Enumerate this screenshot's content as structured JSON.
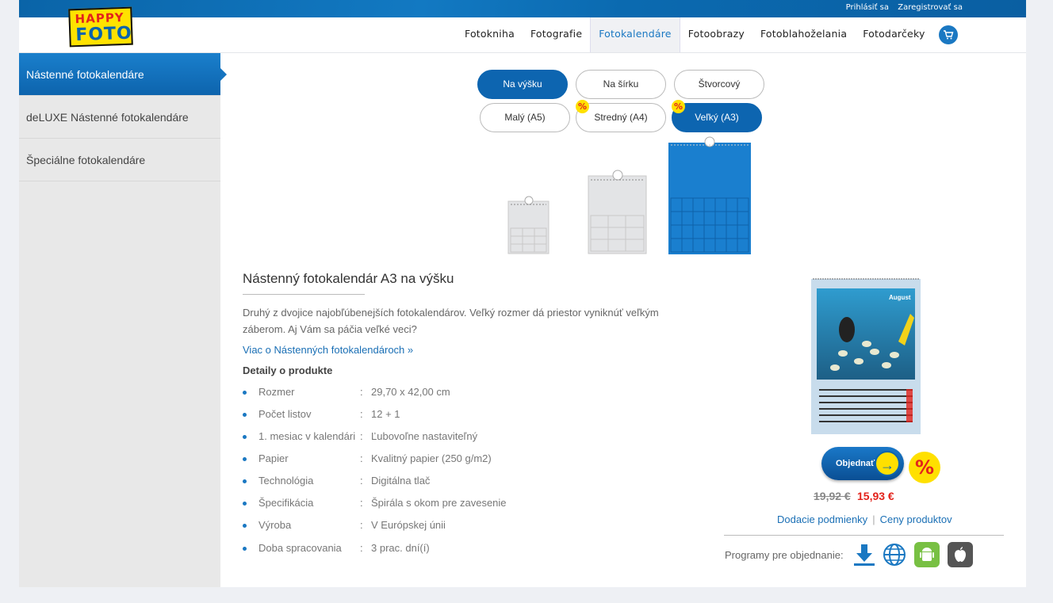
{
  "header": {
    "login": "Prihlásiť sa",
    "register": "Zaregistrovať sa",
    "logo_line1": "HAPPY",
    "logo_line2": "FOTO"
  },
  "nav": [
    {
      "label": "Fotokniha"
    },
    {
      "label": "Fotografie"
    },
    {
      "label": "Fotokalendáre",
      "active": true
    },
    {
      "label": "Fotoobrazy"
    },
    {
      "label": "Fotoblahoželania"
    },
    {
      "label": "Fotodarčeky"
    }
  ],
  "sidebar": [
    {
      "label": "Nástenné fotokalendáre",
      "active": true
    },
    {
      "label": "deLUXE Nástenné fotokalendáre"
    },
    {
      "label": "Špeciálne fotokalendáre"
    }
  ],
  "orientation": [
    "Na výšku",
    "Na šírku",
    "Štvorcový"
  ],
  "sizes": [
    "Malý (A5)",
    "Stredný (A4)",
    "Veľký (A3)"
  ],
  "pct_symbol": "%",
  "product": {
    "title": "Nástenný fotokalendár A3 na výšku",
    "description": "Druhý z dvojice najobľúbenejších fotokalendárov. Veľký rozmer dá priestor vyniknúť veľkým záberom. Aj Vám sa páčia veľké veci?",
    "more_link": "Viac o Nástenných fotokalendároch »",
    "details_heading": "Detaily o produkte",
    "specs": [
      {
        "key": "Rozmer",
        "value": "29,70 x 42,00 cm"
      },
      {
        "key": "Počet listov",
        "value": "12 + 1"
      },
      {
        "key": "1. mesiac v kalendári",
        "value": "Ľubovoľne nastaviteľný"
      },
      {
        "key": "Papier",
        "value": "Kvalitný papier (250 g/m2)"
      },
      {
        "key": "Technológia",
        "value": "Digitálna tlač"
      },
      {
        "key": "Špecifikácia",
        "value": "Špirála s okom pre zavesenie"
      },
      {
        "key": "Výroba",
        "value": "V Európskej únii"
      },
      {
        "key": "Doba spracovania",
        "value": "3 prac. dní(í)"
      }
    ],
    "spec_colon": ":",
    "calendar_month": "August",
    "order_button": "Objednať",
    "old_price": "19,92 €",
    "new_price": "15,93 €",
    "delivery_link": "Dodacie podmienky",
    "link_sep": "|",
    "prices_link": "Ceny produktov",
    "programs_label": "Programy pre objednanie:"
  },
  "colors": {
    "brand_blue": "#0d65b0",
    "sale_red": "#e3231c",
    "sale_yellow": "#ffe000",
    "android_green": "#78c043"
  }
}
